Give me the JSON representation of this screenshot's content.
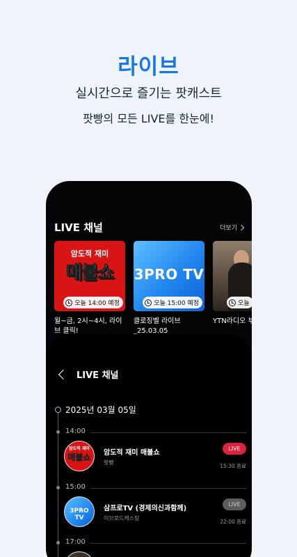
{
  "hero": {
    "title": "라이브",
    "subtitle": "실시간으로 즐기는 팟캐스트",
    "description": "팟빵의 모든 LIVE를 한눈에!"
  },
  "colors": {
    "accent": "#1877e8",
    "live": "#e0213b",
    "background": "#eef4fa"
  },
  "back_screen": {
    "section_title": "LIVE 채널",
    "more_label": "더보기",
    "cards": [
      {
        "logo_small": "암도적 재미",
        "logo_big": "매불쇼",
        "time_badge": "오늘 14:00 예정",
        "caption": "월~금, 2시~4시, 라이브 클릭!"
      },
      {
        "logo_big": "3PRO TV",
        "time_badge": "오늘 15:00 예정",
        "caption": "클로징벨 라이브_25.03.05"
      },
      {
        "time_badge": "오늘",
        "caption": "YTN라디오 부"
      }
    ]
  },
  "front_screen": {
    "title": "LIVE 채널",
    "date": "2025년 03월 05일",
    "times": [
      "14:00",
      "15:00",
      "17:00"
    ],
    "items": [
      {
        "avatar_small": "암도적 재미",
        "avatar_big": "매불쇼",
        "title": "암도적 재미 매불쇼",
        "channel": "팟빵",
        "status": "LIVE",
        "end_time": "15:30 종료"
      },
      {
        "avatar_big": "3PRO TV",
        "title": "삼프로TV (경제의신과함께)",
        "channel": "이브로드캐스팅",
        "status": "LIVE",
        "end_time": "22:00 종료"
      }
    ]
  }
}
